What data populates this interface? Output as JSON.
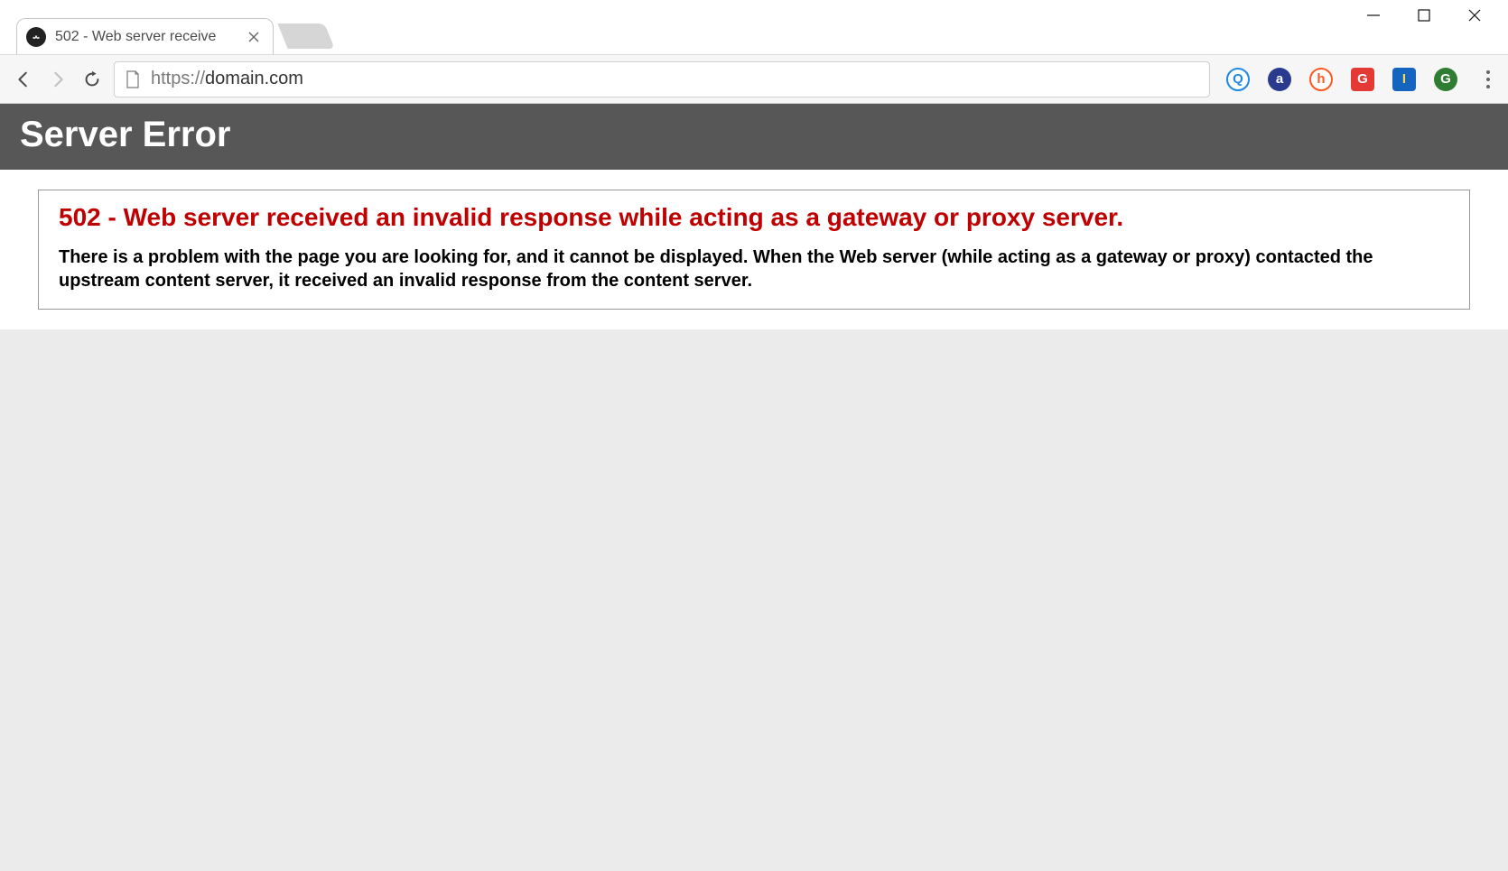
{
  "window": {
    "minimize": "minimize",
    "maximize": "maximize",
    "close": "close"
  },
  "tabs": [
    {
      "title": "502 - Web server receive",
      "active": true
    }
  ],
  "toolbar": {
    "url_scheme": "https://",
    "url_domain": "domain.com"
  },
  "extensions": [
    {
      "label": "Q",
      "bg": "#ffffff",
      "fg": "#1e88e5",
      "border": "#1e88e5",
      "shape": "circle"
    },
    {
      "label": "a",
      "bg": "#2a3b8f",
      "fg": "#ffffff",
      "shape": "circle"
    },
    {
      "label": "h",
      "bg": "#ffffff",
      "fg": "#ff5722",
      "border": "#ff5722",
      "shape": "circle"
    },
    {
      "label": "G",
      "bg": "#e53935",
      "fg": "#ffffff",
      "shape": "square"
    },
    {
      "label": "I",
      "bg": "#1565c0",
      "fg": "#ffd54f",
      "shape": "square"
    },
    {
      "label": "G",
      "bg": "#2e7d32",
      "fg": "#ffffff",
      "shape": "circle"
    }
  ],
  "page": {
    "banner_title": "Server Error",
    "error_heading": "502 - Web server received an invalid response while acting as a gateway or proxy server.",
    "error_body": "There is a problem with the page you are looking for, and it cannot be displayed. When the Web server (while acting as a gateway or proxy) contacted the upstream content server, it received an invalid response from the content server."
  }
}
